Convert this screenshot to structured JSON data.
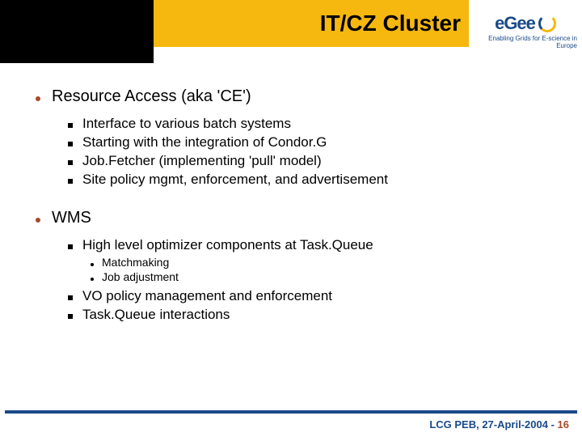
{
  "header": {
    "title": "IT/CZ Cluster",
    "logo_letters": "eGee",
    "logo_tagline": "Enabling Grids for E-science in Europe"
  },
  "sections": [
    {
      "title": "Resource Access (aka 'CE')",
      "items": [
        {
          "text": "Interface to various batch systems"
        },
        {
          "text": "Starting with the integration of Condor.G"
        },
        {
          "text": "Job.Fetcher (implementing 'pull' model)"
        },
        {
          "text": "Site policy mgmt, enforcement, and advertisement"
        }
      ]
    },
    {
      "title": "WMS",
      "items": [
        {
          "text": "High level optimizer components at Task.Queue",
          "children": [
            {
              "text": "Matchmaking"
            },
            {
              "text": "Job adjustment"
            }
          ]
        },
        {
          "text": "VO policy management and enforcement"
        },
        {
          "text": "Task.Queue interactions"
        }
      ]
    }
  ],
  "footer": {
    "left": "LCG PEB, 27-April-2004 - ",
    "page": "16"
  }
}
